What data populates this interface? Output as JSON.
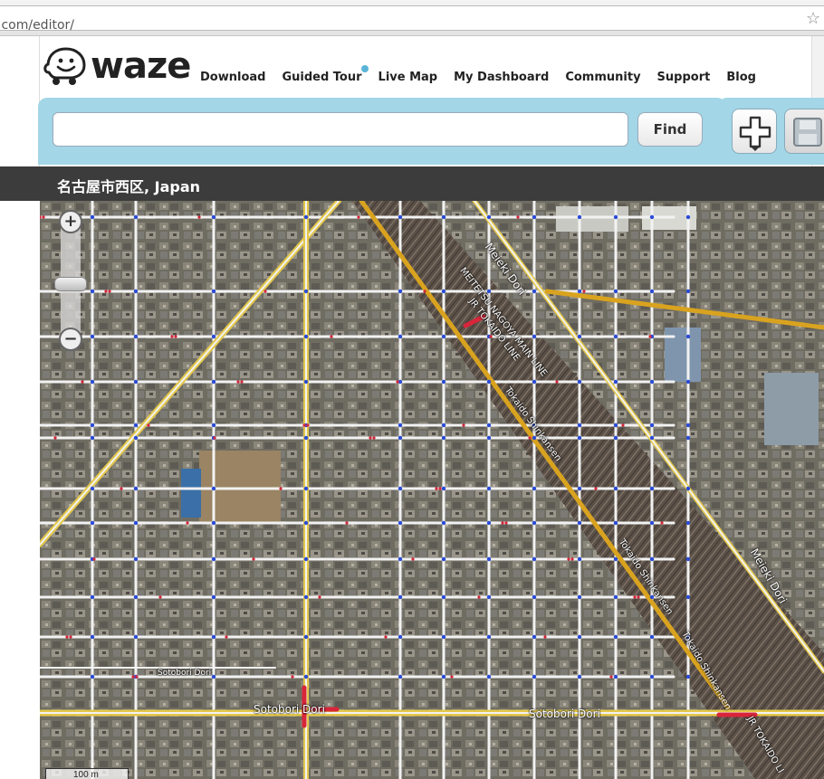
{
  "browser": {
    "url": ".com/editor/"
  },
  "logo": {
    "text": "waze"
  },
  "nav": {
    "items": [
      "Download",
      "Guided Tour",
      "Live Map",
      "My Dashboard",
      "Community",
      "Support",
      "Blog"
    ]
  },
  "toolbar": {
    "search_value": "",
    "find_label": "Find",
    "add_icon": "plus-icon",
    "save_icon": "floppy-icon"
  },
  "location": {
    "title": "名古屋市西区, Japan"
  },
  "map": {
    "labels": {
      "meieki_dori_top": "Meieki Dori",
      "meitetsu_line": "MEITETSU NAGOYA MAIN LINE",
      "jr_tokaido_1": "JR TOKAIDO LINE",
      "tokaido_shinkansen_1": "Tokaido Shinkansen",
      "tokaido_shinkansen_2": "Tokaido Shinkansen",
      "tokaido_shinkansen_3": "Tokaido Shinkansen",
      "meieki_dori_right": "Meieki Dori",
      "sotobori_small": "Sotobori Dori",
      "sotobori_left": "Sotobori Dori",
      "sotobori_mid": "Sotobori Dori",
      "jr_tokaido_2": "JR TOKAIDO LI"
    },
    "scale": "100 m",
    "colors": {
      "street": "#f2f2f2",
      "major_road": "#e3c84b",
      "arterial": "#d9a31f",
      "node": "#2a4bd8",
      "segment_red": "#d8253a"
    }
  }
}
